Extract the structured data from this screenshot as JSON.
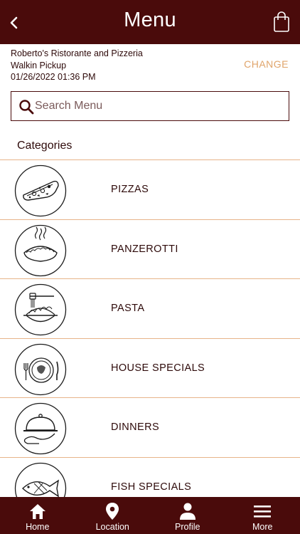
{
  "header": {
    "title": "Menu"
  },
  "order_info": {
    "restaurant": "Roberto's Ristorante and Pizzeria",
    "order_type": "Walkin Pickup",
    "datetime": "01/26/2022 01:36 PM",
    "change_label": "CHANGE"
  },
  "search": {
    "placeholder": "Search Menu"
  },
  "categories": {
    "heading": "Categories",
    "items": [
      {
        "label": "PIZZAS",
        "icon": "pizza-icon"
      },
      {
        "label": "PANZEROTTI",
        "icon": "panzerotti-icon"
      },
      {
        "label": "PASTA",
        "icon": "pasta-icon"
      },
      {
        "label": "HOUSE SPECIALS",
        "icon": "house-specials-icon"
      },
      {
        "label": "DINNERS",
        "icon": "cloche-icon"
      },
      {
        "label": "FISH SPECIALS",
        "icon": "fish-icon"
      }
    ]
  },
  "bottom_nav": {
    "items": [
      {
        "label": "Home",
        "icon": "home-icon"
      },
      {
        "label": "Location",
        "icon": "location-pin-icon"
      },
      {
        "label": "Profile",
        "icon": "person-icon"
      },
      {
        "label": "More",
        "icon": "hamburger-menu-icon"
      }
    ]
  },
  "colors": {
    "brand": "#4a0b0b",
    "accent": "#e0a46a",
    "divider": "#e7b48a"
  }
}
